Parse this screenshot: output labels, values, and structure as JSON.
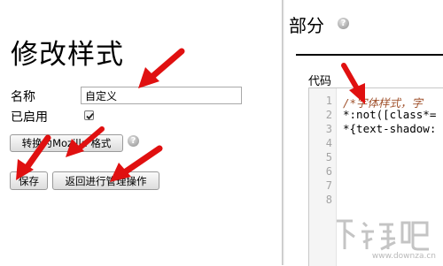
{
  "style_editor": {
    "title": "修改样式",
    "name_label": "名称",
    "name_value": "自定义",
    "enabled_label": "已启用",
    "enabled_checked": true,
    "convert_button_label": "转换为Mozilla 格式",
    "help_glyph": "?",
    "save_button_label": "保存",
    "back_button_label": "返回进行管理操作"
  },
  "section": {
    "title": "部分",
    "code_label": "代码",
    "line_numbers": [
      "1",
      "2",
      "3",
      "4",
      "5",
      "6",
      "7",
      "8"
    ],
    "code_lines": [
      "/*字体样式，字",
      "*:not([class*=",
      "*{text-shadow:"
    ]
  },
  "watermark": {
    "site_text": "www.downza.cn"
  },
  "colors": {
    "annotation_arrow": "#e01010",
    "comment_text": "#a0522d",
    "watermark": "#c4c4c4"
  }
}
